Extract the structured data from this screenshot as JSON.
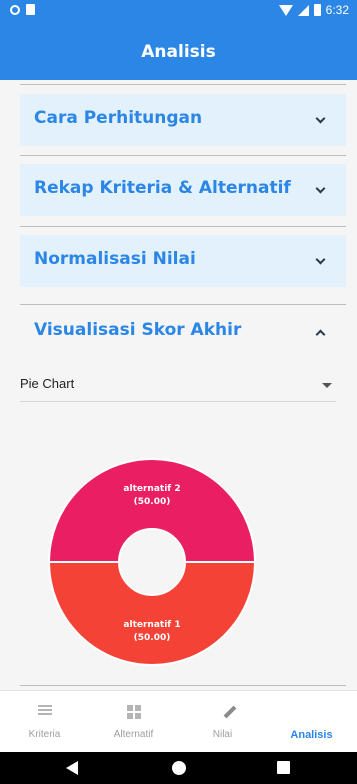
{
  "status_bar": {
    "time": "6:32"
  },
  "app_bar": {
    "title": "Analisis"
  },
  "panels": [
    {
      "title": "Cara Perhitungan",
      "expanded": false
    },
    {
      "title": "Rekap Kriteria & Alternatif",
      "expanded": false
    },
    {
      "title": "Normalisasi Nilai",
      "expanded": false
    },
    {
      "title": "Visualisasi Skor Akhir",
      "expanded": true
    }
  ],
  "visualization": {
    "chart_type_select": {
      "value": "Pie Chart"
    }
  },
  "chart_data": {
    "type": "pie",
    "title": "",
    "donut": true,
    "slices": [
      {
        "label": "alternatif 2",
        "value_label": "(50.00)",
        "value": 50.0,
        "color": "#e91e63"
      },
      {
        "label": "alternatif 1",
        "value_label": "(50.00)",
        "value": 50.0,
        "color": "#f44336"
      }
    ]
  },
  "bottom_nav": {
    "items": [
      {
        "label": "Kriteria",
        "icon": "list-icon",
        "active": false
      },
      {
        "label": "Alternatif",
        "icon": "grid-icon",
        "active": false
      },
      {
        "label": "Nilai",
        "icon": "pencil-icon",
        "active": false
      },
      {
        "label": "Analisis",
        "icon": "bar-chart-icon",
        "active": true
      }
    ]
  },
  "colors": {
    "primary": "#2b86e6",
    "panel_header": "#e3f1fd",
    "slice_1": "#e91e63",
    "slice_2": "#f44336"
  }
}
